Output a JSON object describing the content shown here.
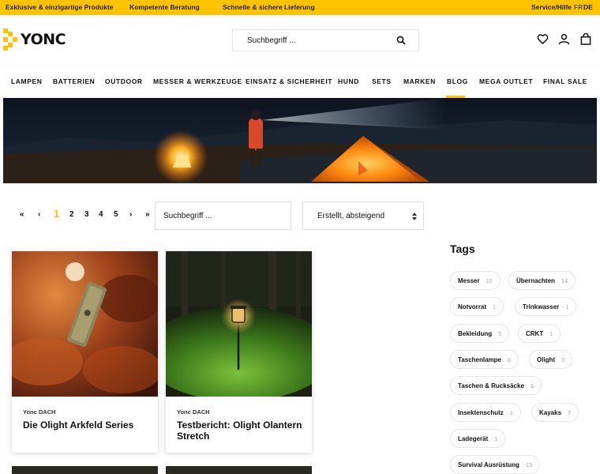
{
  "topbar": {
    "item1": "Exklusive & einzigartige Produkte",
    "item2": "Kompetente Beratung",
    "item3": "Schnelle & sichere Lieferung",
    "service": "Service/Hilfe",
    "lang_fr": "FR",
    "lang_de": "DE"
  },
  "header": {
    "logo_text": "YONC",
    "search_placeholder": "Suchbegriff ..."
  },
  "nav": {
    "items": [
      "LAMPEN",
      "BATTERIEN",
      "OUTDOOR",
      "MESSER & WERKZEUGE",
      "EINSATZ & SICHERHEIT",
      "HUND",
      "SETS",
      "MARKEN",
      "BLOG",
      "MEGA OUTLET",
      "FINAL SALE"
    ],
    "active": "BLOG"
  },
  "pagination": {
    "first": "«",
    "prev": "‹",
    "pages": [
      "1",
      "2",
      "3",
      "4",
      "5"
    ],
    "current": "1",
    "next": "›",
    "last": "»"
  },
  "blog_search": {
    "placeholder": "Suchbegriff ..."
  },
  "sort": {
    "selected": "Erstellt, absteigend"
  },
  "posts": [
    {
      "author": "Yonc DACH",
      "title": "Die Olight Arkfeld Series"
    },
    {
      "author": "Yonc DACH",
      "title": "Testbericht: Olight Olantern Stretch"
    }
  ],
  "tags": {
    "heading": "Tags",
    "items": [
      {
        "name": "Messer",
        "count": "15"
      },
      {
        "name": "Übernachten",
        "count": "14"
      },
      {
        "name": "Notvorrat",
        "count": "1"
      },
      {
        "name": "Trinkwasser",
        "count": "1"
      },
      {
        "name": "Bekleidung",
        "count": "5"
      },
      {
        "name": "CRKT",
        "count": "1"
      },
      {
        "name": "Taschenlampe",
        "count": "6"
      },
      {
        "name": "Olight",
        "count": "3"
      },
      {
        "name": "Taschen & Rucksäcke",
        "count": "6"
      },
      {
        "name": "Insektenschutz",
        "count": "1"
      },
      {
        "name": "Kayaks",
        "count": "7"
      },
      {
        "name": "Ladegerät",
        "count": "1"
      },
      {
        "name": "Survival Ausrüstung",
        "count": "15"
      }
    ]
  },
  "colors": {
    "accent": "#fdc300"
  }
}
